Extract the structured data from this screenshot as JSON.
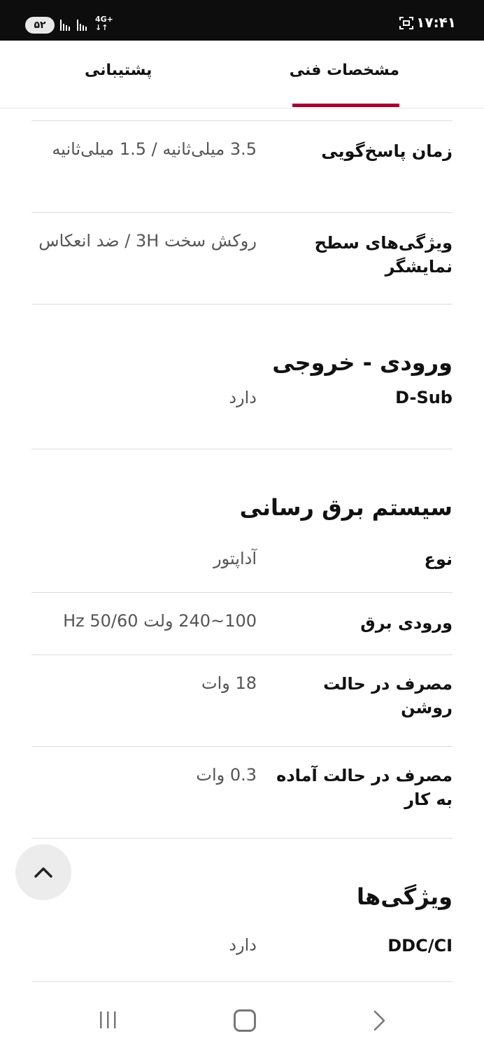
{
  "status_bar": {
    "time": "۱۷:۴۱",
    "battery": "۵۲",
    "network": "4G+"
  },
  "tabs": [
    {
      "label": "مشخصات فنی",
      "active": true
    },
    {
      "label": "پشتیبانی",
      "active": false
    }
  ],
  "colors": {
    "accent": "#a50034"
  },
  "specs_top": [
    {
      "label": "زمان پاسخ‌گویی",
      "value": "3.5 میلی‌ثانیه / 1.5 میلی‌ثانیه"
    },
    {
      "label": "ویژگی‌های سطح نمایشگر",
      "value": "روکش سخت 3H / ضد انعکاس"
    }
  ],
  "sections": {
    "io": {
      "title": "ورودی - خروجی",
      "rows": [
        {
          "label": "D-Sub",
          "value": "دارد"
        }
      ]
    },
    "power": {
      "title": "سیستم برق رسانی",
      "rows": [
        {
          "label": "نوع",
          "value": "آداپتور"
        },
        {
          "label": "ورودی برق",
          "value": "100~240 ولت 50/60 Hz"
        },
        {
          "label": "مصرف در حالت روشن",
          "value": "18 وات"
        },
        {
          "label": "مصرف در حالت آماده به کار",
          "value": "0.3 وات"
        }
      ]
    },
    "features": {
      "title": "ویژگی‌ها",
      "rows": [
        {
          "label": "DDC/CI",
          "value": "دارد"
        }
      ]
    }
  },
  "icons": {
    "scroll_top": "chevron-up-icon",
    "nav_recent": "recent-apps-icon",
    "nav_home": "home-icon",
    "nav_back": "back-icon"
  }
}
